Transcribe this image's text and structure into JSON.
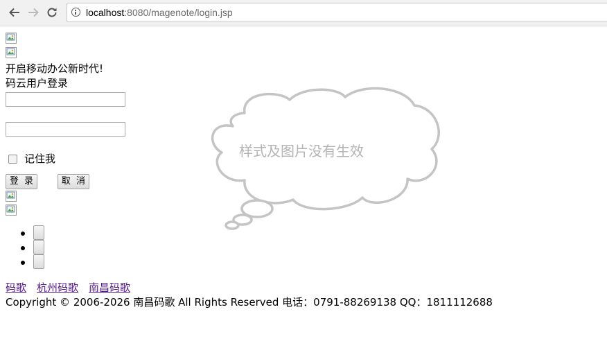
{
  "browser": {
    "url_host": "localhost",
    "url_path": ":8080/magenote/login.jsp"
  },
  "page": {
    "slogan": "开启移动办公新时代!",
    "login_title": "码云用户登录",
    "username_value": "",
    "password_value": "",
    "remember_label": "记住我",
    "login_button": "登 录",
    "cancel_button": "取 消",
    "links": [
      "码歌",
      "杭州码歌",
      "南昌码歌"
    ],
    "copyright": "Copyright © 2006-2026 南昌码歌 All Rights Reserved 电话：0791-88269138 QQ：1811112688"
  },
  "overlay": {
    "cloud_text": "样式及图片没有生效"
  },
  "colors": {
    "cloud_stroke": "#c4c4c4",
    "cloud_text": "#b4b4b4",
    "visited_link": "#551a8b"
  }
}
